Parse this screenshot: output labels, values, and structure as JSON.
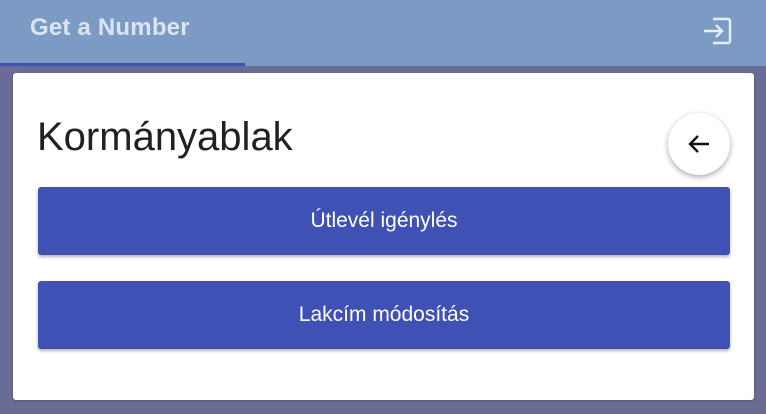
{
  "header": {
    "tab_label": "Get a Number",
    "logout_icon": "logout-icon"
  },
  "card": {
    "title": "Kormányablak",
    "back_icon": "arrow-left-icon",
    "buttons": [
      {
        "label": "Útlevél igénylés"
      },
      {
        "label": "Lakcím módosítás"
      }
    ]
  },
  "colors": {
    "header_bg": "#7b9bc5",
    "page_bg": "#6b6c95",
    "primary": "#3f51b5",
    "card_bg": "#ffffff"
  }
}
